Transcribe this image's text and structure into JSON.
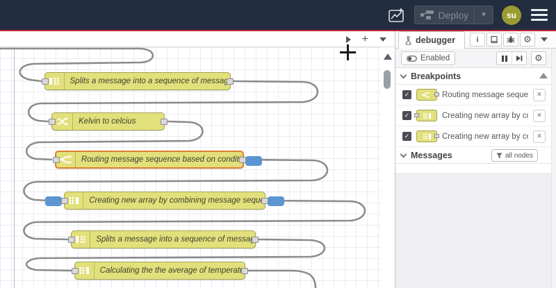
{
  "header": {
    "deploy_label": "Deploy",
    "avatar_initials": "su"
  },
  "workspace": {
    "nodes": [
      {
        "type": "split",
        "label": "Splits a message into a sequence of messages.",
        "selected": false
      },
      {
        "type": "change",
        "label": "Kelvin to celcius",
        "selected": false
      },
      {
        "type": "switch",
        "label": "Routing message sequence based on condition",
        "selected": true
      },
      {
        "type": "join",
        "label": "Creating new array by combining message sequence",
        "selected": false
      },
      {
        "type": "split",
        "label": "Splits a message into a sequence of messages.",
        "selected": false
      },
      {
        "type": "join",
        "label": "Calculating the the average of temperature",
        "selected": false
      }
    ]
  },
  "sidebar": {
    "tab_label": "debugger",
    "info_glyph": "i",
    "debug_toolbar": {
      "enabled_label": "Enabled"
    },
    "breakpoints": {
      "title": "Breakpoints",
      "check_glyph": "✓",
      "close_glyph": "×",
      "items": [
        {
          "node_type": "switch",
          "label": "Routing message sequence ba",
          "checked": true
        },
        {
          "node_type": "join",
          "label": "Creating new array by combini",
          "checked": true
        },
        {
          "node_type": "join",
          "label": "Creating new array by combini",
          "checked": true
        }
      ]
    },
    "messages": {
      "title": "Messages",
      "filter_label": "all nodes"
    }
  },
  "colors": {
    "header_bg": "#222d3f",
    "header_accent_line": "#c22235",
    "node_yellow": "#e2e07b",
    "node_border": "#a3a356",
    "selected_border": "#de7f2c",
    "queue_pill_blue": "#5b96d2",
    "avatar_olive": "#9a9c31",
    "wire_gray": "#8c8c8c"
  }
}
